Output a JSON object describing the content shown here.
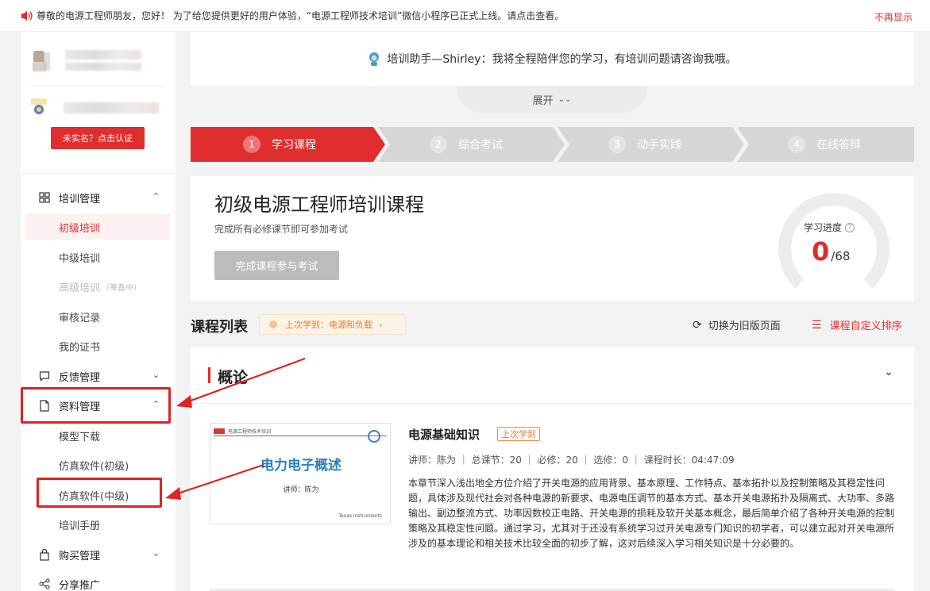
{
  "notice": {
    "text": "尊敬的电源工程师朋友，您好！ 为了给您提供更好的用户体验，“电源工程师技术培训”微信小程序已正式上线。请点击查看。",
    "close_label": "不再显示"
  },
  "sidebar": {
    "verify_label": "未实名？点击认证",
    "groups": [
      {
        "label": "培训管理",
        "expanded": true,
        "items": [
          {
            "label": "初级培训",
            "active": true
          },
          {
            "label": "中级培训"
          },
          {
            "label": "高级培训",
            "tag": "（筹备中）",
            "disabled": true
          },
          {
            "label": "审核记录"
          },
          {
            "label": "我的证书"
          }
        ]
      },
      {
        "label": "反馈管理",
        "expanded": false
      },
      {
        "label": "资料管理",
        "expanded": true,
        "items": [
          {
            "label": "模型下载"
          },
          {
            "label": "仿真软件(初级)"
          },
          {
            "label": "仿真软件(中级)"
          },
          {
            "label": "培训手册"
          }
        ]
      },
      {
        "label": "购买管理",
        "expanded": false
      },
      {
        "label": "分享推广",
        "expanded": false
      }
    ]
  },
  "assistant": {
    "text": "培训助手—Shirley：我将全程陪伴您的学习，有培训问题请咨询我哦。",
    "expand_label": "展开"
  },
  "steps": [
    {
      "num": "1",
      "label": "学习课程",
      "active": true
    },
    {
      "num": "2",
      "label": "综合考试"
    },
    {
      "num": "3",
      "label": "动手实践"
    },
    {
      "num": "4",
      "label": "在线答辩"
    }
  ],
  "course": {
    "title": "初级电源工程师培训课程",
    "subtitle": "完成所有必修课节即可参加考试",
    "exam_button": "完成课程参与考试",
    "progress_label": "学习进度",
    "progress_done": "0",
    "progress_total": "/68",
    "progress_fraction": 0
  },
  "list": {
    "title": "课程列表",
    "last_study": "上次学到：电源和负载",
    "switch_old": "切换为旧版页面",
    "custom_sort": "课程自定义排序"
  },
  "chapter": {
    "title": "概论",
    "lesson": {
      "title": "电源基础知识",
      "tag": "上次学到",
      "meta": "讲师：陈为 ｜ 总课节：20 ｜ 必修：20 ｜ 选修：0 ｜ 课程时长：04:47:09",
      "description": "本章节深入浅出地全方位介绍了开关电源的应用背景、基本原理、工作特点、基本拓扑以及控制策略及其稳定性问题，具体涉及现代社会对各种电源的新要求、电源电压调节的基本方式、基本开关电源拓扑及隔离式、大功率、多路输出、副边整流方式、功率因数校正电路、开关电源的损耗及软开关基本概念，最后简单介绍了各种开关电源的控制策略及其稳定性问题。通过学习，尤其对于还没有系统学习过开关电源专门知识的初学者，可以建立起对开关电源所涉及的基本理论和相关技术比较全面的初步了解，这对后续深入学习相关知识是十分必要的。",
      "thumb_title": "电力电子概述",
      "thumb_author": "讲师：陈为",
      "thumb_header": "电源工程师技术培训",
      "thumb_footer": "Texas Instruments"
    }
  },
  "colors": {
    "accent": "#e02d2d",
    "step_inactive": "#d4d4d4",
    "tag_orange": "#f07a2c"
  }
}
